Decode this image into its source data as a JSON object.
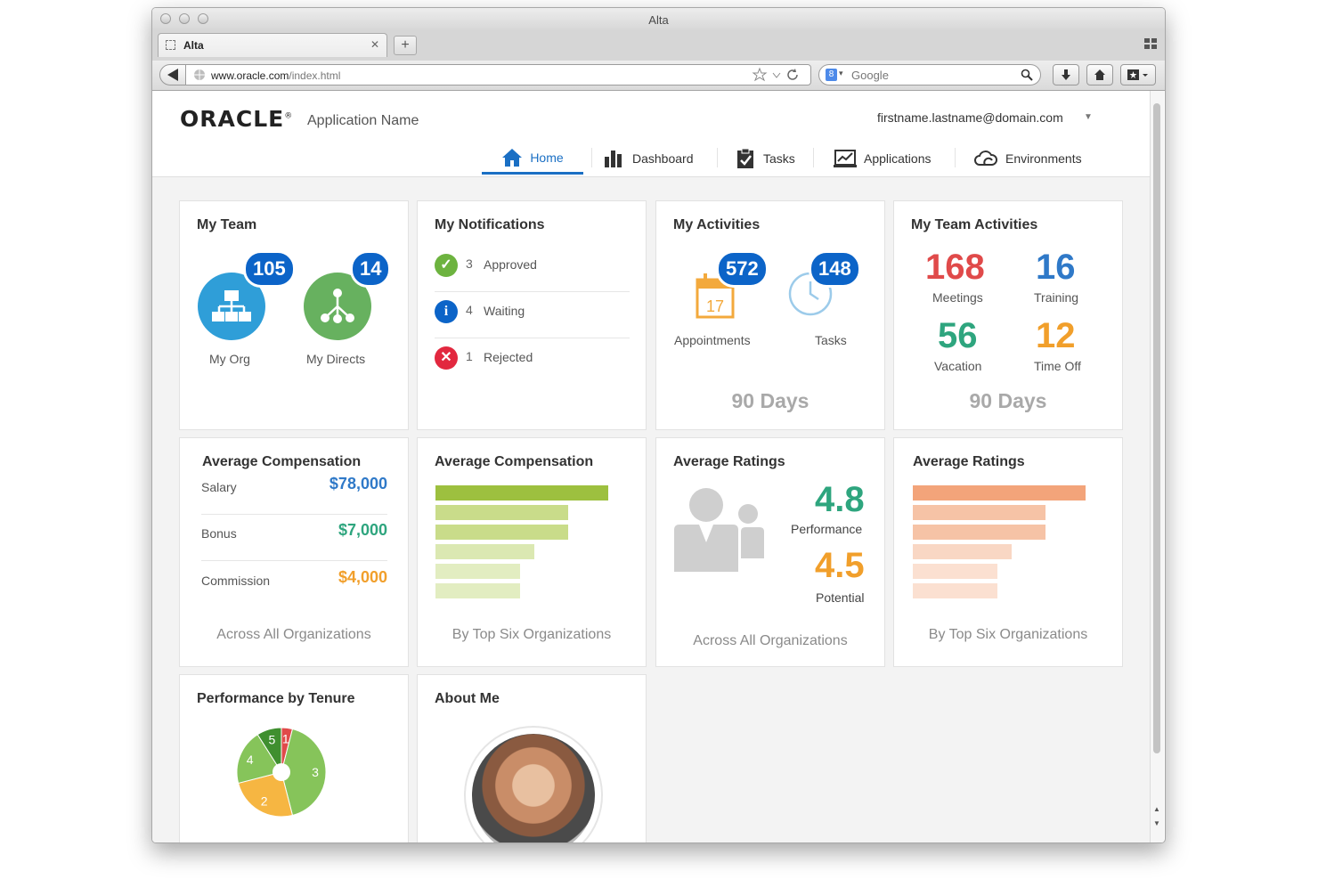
{
  "browser": {
    "window_title": "Alta",
    "tab_label": "Alta",
    "url_host": "www.oracle.com",
    "url_path": "/index.html",
    "search_placeholder": "Google"
  },
  "header": {
    "logo_text": "ORACLE",
    "app_name": "Application Name",
    "user_email": "firstname.lastname@domain.com"
  },
  "nav": {
    "tabs": [
      {
        "label": "Home",
        "icon": "home-icon",
        "active": true
      },
      {
        "label": "Dashboard",
        "icon": "bar-chart-icon",
        "active": false
      },
      {
        "label": "Tasks",
        "icon": "clipboard-check-icon",
        "active": false
      },
      {
        "label": "Applications",
        "icon": "line-chart-icon",
        "active": false
      },
      {
        "label": "Environments",
        "icon": "cloud-icon",
        "active": false
      }
    ],
    "accent": "#1a6fc4"
  },
  "my_team": {
    "title": "My Team",
    "items": [
      {
        "label": "My Org",
        "count": "105",
        "icon": "org-chart-icon",
        "color": "#2f9ed8"
      },
      {
        "label": "My Directs",
        "count": "14",
        "icon": "hierarchy-icon",
        "color": "#67b15f"
      }
    ]
  },
  "notifications": {
    "title": "My Notifications",
    "items": [
      {
        "count": "3",
        "label": "Approved",
        "icon": "check-icon",
        "color": "#6db33f"
      },
      {
        "count": "4",
        "label": "Waiting",
        "icon": "info-icon",
        "color": "#0c64c8"
      },
      {
        "count": "1",
        "label": "Rejected",
        "icon": "x-icon",
        "color": "#e2283f"
      }
    ]
  },
  "activities": {
    "title": "My Activities",
    "items": [
      {
        "label": "Appointments",
        "count": "572",
        "icon": "calendar-icon",
        "calendar_day": "17"
      },
      {
        "label": "Tasks",
        "count": "148",
        "icon": "clock-icon"
      }
    ],
    "period": "90 Days"
  },
  "team_activities": {
    "title": "My Team Activities",
    "stats": [
      {
        "value": "168",
        "label": "Meetings",
        "color": "#e04a4a"
      },
      {
        "value": "16",
        "label": "Training",
        "color": "#2f79c8"
      },
      {
        "value": "56",
        "label": "Vacation",
        "color": "#2ea57e"
      },
      {
        "value": "12",
        "label": "Time Off",
        "color": "#f19f2b"
      }
    ],
    "period": "90 Days"
  },
  "avg_comp_list": {
    "title": "Average Compensation",
    "rows": [
      {
        "label": "Salary",
        "value": "$78,000",
        "color": "#2f79c8"
      },
      {
        "label": "Bonus",
        "value": "$7,000",
        "color": "#2ea57e"
      },
      {
        "label": "Commission",
        "value": "$4,000",
        "color": "#f19f2b"
      }
    ],
    "footer": "Across All Organizations"
  },
  "avg_comp_bars": {
    "title": "Average Compensation",
    "footer": "By Top Six Organizations",
    "bars": [
      {
        "fraction": 1.0,
        "color": "#9dc03f"
      },
      {
        "fraction": 0.77,
        "color": "#c9dc8a"
      },
      {
        "fraction": 0.77,
        "color": "#c9dc8a"
      },
      {
        "fraction": 0.57,
        "color": "#dbe8b2"
      },
      {
        "fraction": 0.49,
        "color": "#e2edc1"
      },
      {
        "fraction": 0.49,
        "color": "#e2edc1"
      }
    ]
  },
  "avg_ratings": {
    "title": "Average Ratings",
    "performance_value": "4.8",
    "performance_label": "Performance",
    "performance_color": "#2ea57e",
    "potential_value": "4.5",
    "potential_label": "Potential",
    "potential_color": "#f19f2b",
    "footer": "Across All Organizations"
  },
  "avg_ratings_bars": {
    "title": "Average Ratings",
    "footer": "By Top Six Organizations",
    "bars": [
      {
        "fraction": 1.0,
        "color": "#f3a47a"
      },
      {
        "fraction": 0.77,
        "color": "#f6c3a6"
      },
      {
        "fraction": 0.77,
        "color": "#f6c3a6"
      },
      {
        "fraction": 0.57,
        "color": "#f9d7c4"
      },
      {
        "fraction": 0.49,
        "color": "#fbe0d1"
      },
      {
        "fraction": 0.49,
        "color": "#fbe0d1"
      }
    ]
  },
  "perf_tenure": {
    "title": "Performance by Tenure",
    "chart_data": {
      "type": "pie",
      "slices": [
        {
          "label": "1",
          "value": 4,
          "color": "#e04a4a"
        },
        {
          "label": "3",
          "value": 42,
          "color": "#86c45a"
        },
        {
          "label": "2",
          "value": 25,
          "color": "#f6b642"
        },
        {
          "label": "4",
          "value": 20,
          "color": "#86c45a"
        },
        {
          "label": "5",
          "value": 9,
          "color": "#3f8f2f"
        }
      ]
    }
  },
  "about_me": {
    "title": "About Me"
  }
}
